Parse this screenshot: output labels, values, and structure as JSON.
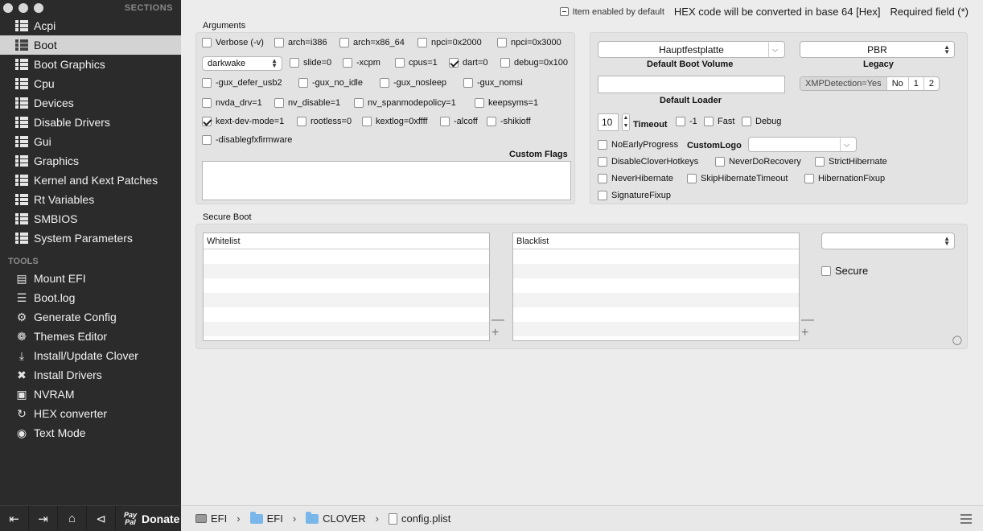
{
  "sidebar": {
    "sections_header": "SECTIONS",
    "tools_header": "TOOLS",
    "sections": [
      {
        "label": "Acpi"
      },
      {
        "label": "Boot"
      },
      {
        "label": "Boot Graphics"
      },
      {
        "label": "Cpu"
      },
      {
        "label": "Devices"
      },
      {
        "label": "Disable Drivers"
      },
      {
        "label": "Gui"
      },
      {
        "label": "Graphics"
      },
      {
        "label": "Kernel and Kext Patches"
      },
      {
        "label": "Rt Variables"
      },
      {
        "label": "SMBIOS"
      },
      {
        "label": "System Parameters"
      }
    ],
    "active_section": "Boot",
    "tools": [
      {
        "label": "Mount EFI",
        "icon": "drive-icon"
      },
      {
        "label": "Boot.log",
        "icon": "document-icon"
      },
      {
        "label": "Generate Config",
        "icon": "gear-icon"
      },
      {
        "label": "Themes Editor",
        "icon": "palette-icon"
      },
      {
        "label": "Install/Update Clover",
        "icon": "download-icon"
      },
      {
        "label": "Install Drivers",
        "icon": "tools-icon"
      },
      {
        "label": "NVRAM",
        "icon": "chip-icon"
      },
      {
        "label": "HEX converter",
        "icon": "refresh-icon"
      },
      {
        "label": "Text Mode",
        "icon": "eye-icon"
      }
    ],
    "donate_label": "Donate",
    "paypal_line1": "Pay",
    "paypal_line2": "Pal"
  },
  "topbar": {
    "item_enabled": "Item enabled by default",
    "hex_note": "HEX code will be converted in base 64 [Hex]",
    "required": "Required field (*)"
  },
  "arguments": {
    "title": "Arguments",
    "darkwake_value": "darkwake",
    "custom_flags_label": "Custom Flags",
    "checkboxes": [
      {
        "label": "Verbose (-v)",
        "checked": false
      },
      {
        "label": "arch=i386",
        "checked": false
      },
      {
        "label": "arch=x86_64",
        "checked": false
      },
      {
        "label": "npci=0x2000",
        "checked": false
      },
      {
        "label": "npci=0x3000",
        "checked": false
      },
      {
        "label": "slide=0",
        "checked": false
      },
      {
        "label": "-xcpm",
        "checked": false
      },
      {
        "label": "cpus=1",
        "checked": false
      },
      {
        "label": "dart=0",
        "checked": true
      },
      {
        "label": "debug=0x100",
        "checked": false
      },
      {
        "label": "-gux_defer_usb2",
        "checked": false
      },
      {
        "label": "-gux_no_idle",
        "checked": false
      },
      {
        "label": "-gux_nosleep",
        "checked": false
      },
      {
        "label": "-gux_nomsi",
        "checked": false
      },
      {
        "label": "nvda_drv=1",
        "checked": false
      },
      {
        "label": "nv_disable=1",
        "checked": false
      },
      {
        "label": "nv_spanmodepolicy=1",
        "checked": false
      },
      {
        "label": "keepsyms=1",
        "checked": false
      },
      {
        "label": "kext-dev-mode=1",
        "checked": true
      },
      {
        "label": "rootless=0",
        "checked": false
      },
      {
        "label": "kextlog=0xffff",
        "checked": false
      },
      {
        "label": "-alcoff",
        "checked": false
      },
      {
        "label": "-shikioff",
        "checked": false
      },
      {
        "label": "-disablegfxfirmware",
        "checked": false
      }
    ]
  },
  "boot": {
    "default_volume_value": "Hauptfestplatte",
    "default_volume_label": "Default Boot Volume",
    "legacy_value": "PBR",
    "legacy_label": "Legacy",
    "default_loader_label": "Default Loader",
    "xmp_options": [
      "XMPDetection=Yes",
      "No",
      "1",
      "2"
    ],
    "xmp_selected": "XMPDetection=Yes",
    "timeout_value": "10",
    "timeout_label": "Timeout",
    "custom_logo_label": "CustomLogo",
    "checkboxes": [
      {
        "label": "-1",
        "checked": false
      },
      {
        "label": "Fast",
        "checked": false
      },
      {
        "label": "Debug",
        "checked": false
      },
      {
        "label": "NoEarlyProgress",
        "checked": false
      },
      {
        "label": "DisableCloverHotkeys",
        "checked": false
      },
      {
        "label": "NeverDoRecovery",
        "checked": false
      },
      {
        "label": "StrictHibernate",
        "checked": false
      },
      {
        "label": "NeverHibernate",
        "checked": false
      },
      {
        "label": "SkipHibernateTimeout",
        "checked": false
      },
      {
        "label": "HibernationFixup",
        "checked": false
      },
      {
        "label": "SignatureFixup",
        "checked": false
      }
    ]
  },
  "secure_boot": {
    "title": "Secure Boot",
    "whitelist_header": "Whitelist",
    "blacklist_header": "Blacklist",
    "secure_label": "Secure",
    "secure_checked": false
  },
  "breadcrumb": {
    "items": [
      "EFI",
      "EFI",
      "CLOVER",
      "config.plist"
    ]
  }
}
